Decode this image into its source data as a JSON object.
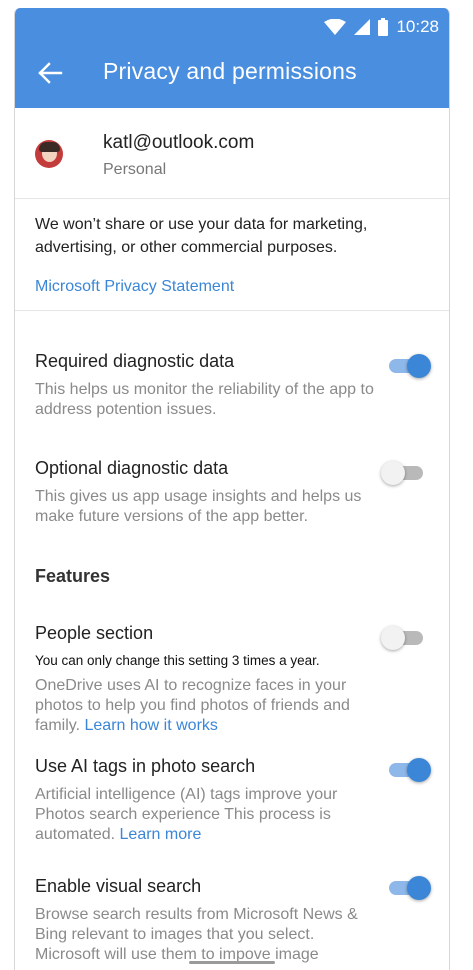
{
  "status_bar": {
    "time": "10:28"
  },
  "header": {
    "title": "Privacy and permissions",
    "back_icon": "arrow-left-icon"
  },
  "account": {
    "email": "katl@outlook.com",
    "type": "Personal"
  },
  "privacy": {
    "text": "We won’t share or use your data for marketing, advertising, or other commercial purposes.",
    "link": "Microsoft Privacy Statement"
  },
  "settings": {
    "required": {
      "title": "Required diagnostic data",
      "desc": "This helps us monitor the reliability of the app to address potention issues.",
      "enabled": true
    },
    "optional": {
      "title": "Optional diagnostic data",
      "desc": "This gives us app usage insights and helps us make future versions of the app better.",
      "enabled": false
    }
  },
  "features": {
    "heading": "Features",
    "people": {
      "title": "People section",
      "note": "You can only change this setting 3 times a year.",
      "desc": "OneDrive uses AI to recognize faces in your photos to help you find photos of friends and family.",
      "link": "Learn how it works",
      "enabled": false
    },
    "ai_tags": {
      "title": "Use AI tags in photo search",
      "desc": "Artificial intelligence (AI) tags improve your Photos search experience This process is automated.",
      "link": "Learn more",
      "enabled": true
    },
    "visual_search": {
      "title": "Enable visual search",
      "desc": "Browse search results from Microsoft News & Bing relevant to images that you select. Microsoft will use them to impove image",
      "enabled": true
    }
  },
  "colors": {
    "appbar": "#4a8ee0",
    "accent": "#3b86d6"
  }
}
